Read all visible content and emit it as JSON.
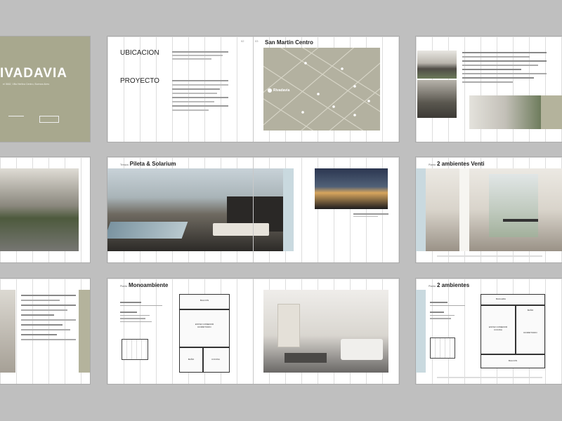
{
  "cover": {
    "title": "IVADAVIA",
    "subtitle": "el 3662, Villa Herlina Centro, Buenos Aires"
  },
  "ubicacion": {
    "heading_1": "UBICACION",
    "heading_2": "PROYECTO",
    "map_title": "San Martín Centro",
    "map_brand": "Rivadavia",
    "page_left": "02",
    "page_right": "03"
  },
  "amenities": {
    "label": "Terraza",
    "title": "Pileta & Solarium"
  },
  "venti": {
    "label": "Planta",
    "title": "2 ambientes Venti"
  },
  "mono": {
    "label": "Planta",
    "title": "Monoambiente",
    "rooms": {
      "balcon": "BALCON",
      "estar": "ESTAR COMEDOR\nDORMITORIO",
      "bano": "BAÑO",
      "cocina": "COCINA"
    }
  },
  "dos_amb": {
    "label": "Planta",
    "title": "2 ambientes",
    "rooms": {
      "baulera": "BAULERA",
      "estar": "ESTAR COMEDOR\nCOCINA",
      "dormitorio": "DORMITORIO",
      "balcon": "BALCON",
      "bano": "BAÑO"
    }
  }
}
